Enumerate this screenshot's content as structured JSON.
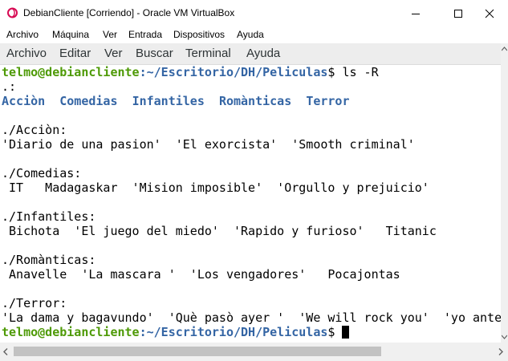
{
  "window": {
    "title": "DebianCliente  [Corriendo] - Oracle VM VirtualBox"
  },
  "vbox_menu": [
    "Archivo",
    "Máquina",
    "Ver",
    "Entrada",
    "Dispositivos",
    "Ayuda"
  ],
  "terminal_menu": [
    "Archivo",
    "Editar",
    "Ver",
    "Buscar",
    "Terminal",
    "Ayuda"
  ],
  "prompt": {
    "user_host": "telmo@debiancliente",
    "path": ":~/Escritorio/DH/Peliculas",
    "symbol": "$ ",
    "command": "ls -R"
  },
  "output": {
    "root_label": ".:",
    "root_dirs": [
      "Acciòn",
      "Comedias",
      "Infantiles",
      "Romànticas",
      "Terror"
    ],
    "accion_header": "./Acciòn:",
    "accion_files": "'Diario de una pasion'  'El exorcista'  'Smooth criminal'",
    "comedias_header": "./Comedias:",
    "comedias_files": " IT   Madagaskar  'Mision imposible'  'Orgullo y prejuicio'",
    "infantiles_header": "./Infantiles:",
    "infantiles_files": " Bichota  'El juego del miedo'  'Rapido y furioso'   Titanic",
    "romanticas_header": "./Romànticas:",
    "romanticas_files": " Anavelle  'La mascara '  'Los vengadores'   Pocajontas",
    "terror_header": "./Terror:",
    "terror_files": "'La dama y bagavundo'  'Què pasò ayer '  'We will rock you'  'yo ante"
  },
  "colors": {
    "prompt_user": "#4e9a06",
    "prompt_path": "#3465a4",
    "directory": "#3465a4"
  }
}
